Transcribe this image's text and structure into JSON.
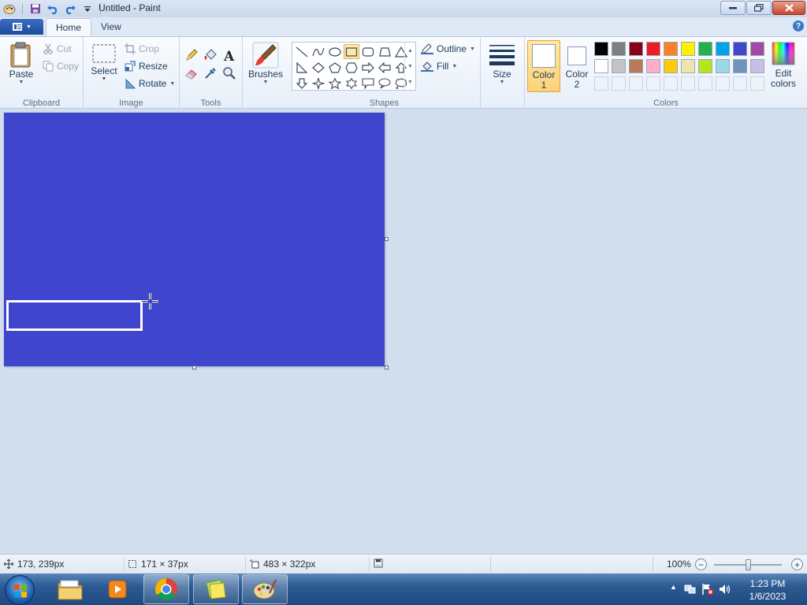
{
  "window": {
    "title": "Untitled - Paint"
  },
  "tabs": [
    {
      "label": "Home"
    },
    {
      "label": "View"
    }
  ],
  "ribbon": {
    "clipboard": {
      "label": "Clipboard",
      "paste": "Paste",
      "cut": "Cut",
      "copy": "Copy"
    },
    "image": {
      "label": "Image",
      "select": "Select",
      "crop": "Crop",
      "resize": "Resize",
      "rotate": "Rotate"
    },
    "tools": {
      "label": "Tools",
      "items": [
        "pencil-icon",
        "fill-icon",
        "text-icon",
        "eraser-icon",
        "color-picker-icon",
        "magnifier-icon"
      ]
    },
    "brushes": {
      "label": "Brushes"
    },
    "shapes": {
      "label": "Shapes",
      "outline": "Outline",
      "fill": "Fill",
      "selected": "rectangle"
    },
    "size": {
      "label": "Size"
    },
    "colors": {
      "label": "Colors",
      "color1_label": "Color 1",
      "color2_label": "Color 2",
      "color1": "#ffffff",
      "color2": "#ffffff",
      "edit_colors": "Edit colors",
      "palette_row1": [
        "#000000",
        "#7f7f7f",
        "#880015",
        "#ed1c24",
        "#ff7f27",
        "#fff200",
        "#22b14c",
        "#00a2e8",
        "#3f48cc",
        "#a349a4"
      ],
      "palette_row2": [
        "#ffffff",
        "#c3c3c3",
        "#b97a57",
        "#ffaec9",
        "#ffc90e",
        "#efe4b0",
        "#b5e61d",
        "#99d9ea",
        "#7092be",
        "#c8bfe7"
      ]
    }
  },
  "canvas": {
    "background": "#3f45cc"
  },
  "status": {
    "cursor_pos": "173, 239px",
    "selection_size": "171 × 37px",
    "image_size": "483 × 322px",
    "zoom": "100%",
    "zoom_level": 1.0
  },
  "taskbar": {
    "apps": [
      "file-explorer-icon",
      "media-player-icon",
      "chrome-icon",
      "sticky-notes-icon",
      "paint-icon"
    ],
    "time": "1:23 PM",
    "date": "1/6/2023"
  }
}
